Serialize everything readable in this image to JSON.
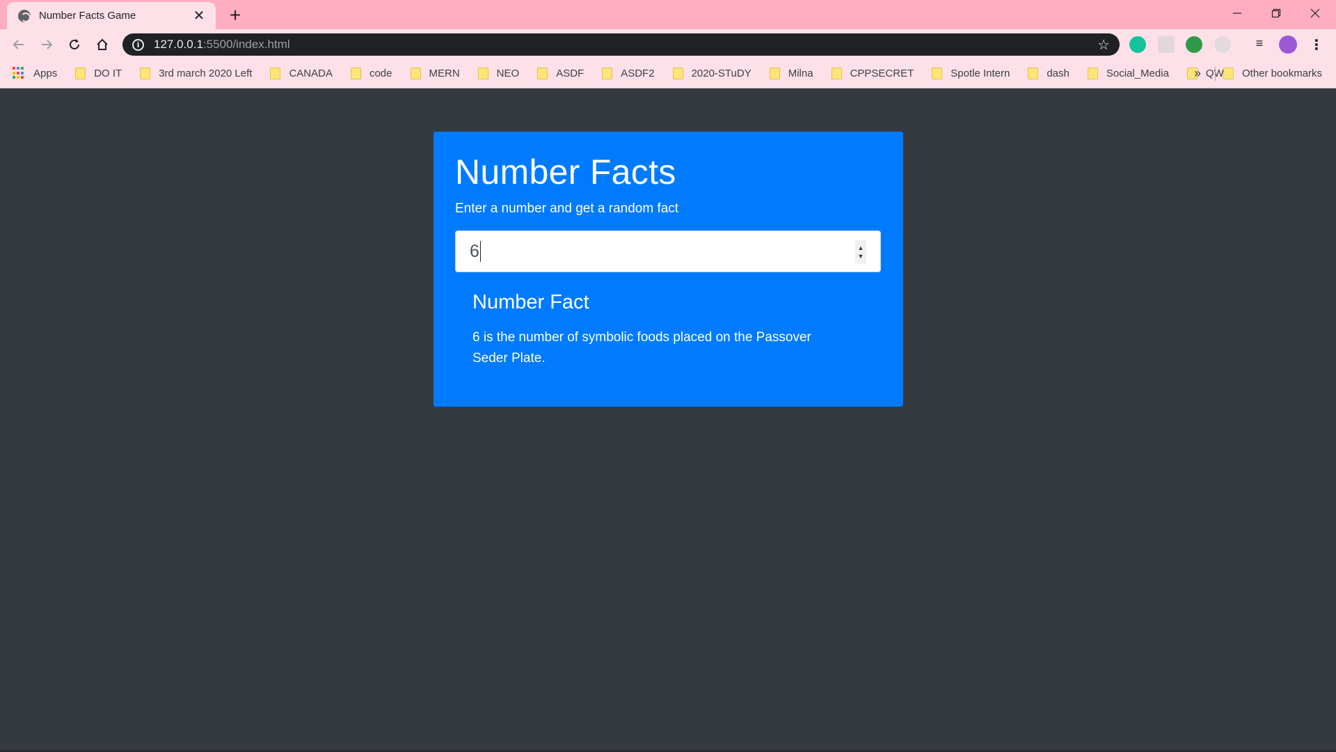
{
  "browser": {
    "tab_title": "Number Facts Game",
    "url_host": "127.0.0.1",
    "url_rest": ":5500/index.html",
    "bookmarks": [
      "Apps",
      "DO IT",
      "3rd march 2020 Left",
      "CANADA",
      "code",
      "MERN",
      "NEO",
      "ASDF",
      "ASDF2",
      "2020-STuDY",
      "Milna",
      "CPPSECRET",
      "Spotle Intern",
      "dash",
      "Social_Media",
      "QWQ"
    ],
    "overflow": "»",
    "other_bookmarks": "Other bookmarks",
    "theme_color": "#ffadc0"
  },
  "page": {
    "title": "Number Facts",
    "subtitle": "Enter a number and get a random fact",
    "input_value": "6",
    "fact_heading": "Number Fact",
    "fact_text": "6 is the number of symbolic foods placed on the Passover Seder Plate.",
    "card_color": "#007bff",
    "background_color": "#343a40"
  }
}
